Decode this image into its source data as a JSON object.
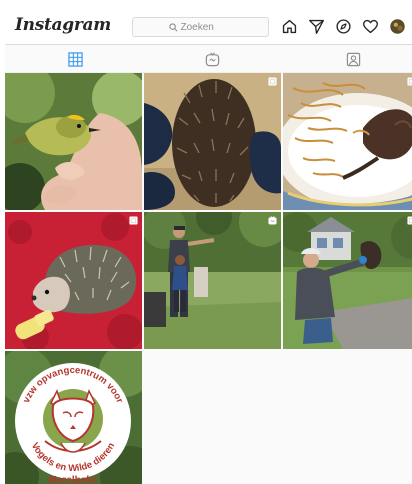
{
  "header": {
    "logo_text": "Instagram",
    "search": {
      "placeholder": "Zoeken"
    },
    "nav_icons": [
      "home-icon",
      "direct-icon",
      "explore-icon",
      "activity-heart-icon",
      "profile-avatar"
    ]
  },
  "tabs": [
    {
      "icon": "grid-icon",
      "active": true,
      "color": "#3897f0"
    },
    {
      "icon": "igtv-icon",
      "active": false
    },
    {
      "icon": "tagged-icon",
      "active": false
    }
  ],
  "posts": [
    {
      "subject": "bird-in-hand",
      "badge": "none"
    },
    {
      "subject": "hedgehog-gloved-hands",
      "badge": "multi-photo-icon"
    },
    {
      "subject": "bird-on-plate",
      "badge": "multi-photo-icon"
    },
    {
      "subject": "baby-hedgehog-on-towel",
      "badge": "multi-photo-icon"
    },
    {
      "subject": "man-and-child-garden",
      "badge": "igtv-icon"
    },
    {
      "subject": "man-releasing-bird",
      "badge": "multi-photo-icon"
    },
    {
      "subject": "logo-tile",
      "badge": "none"
    }
  ],
  "logo_tile": {
    "arc_top": "vzw opvangcentrum voor",
    "arc_bottom": "Vogels en Wilde dieren",
    "line_bottom": "Merelbeke"
  },
  "colors": {
    "accent_blue": "#3897f0",
    "logo_red": "#b5362f",
    "logo_green": "#7a9a3a"
  }
}
